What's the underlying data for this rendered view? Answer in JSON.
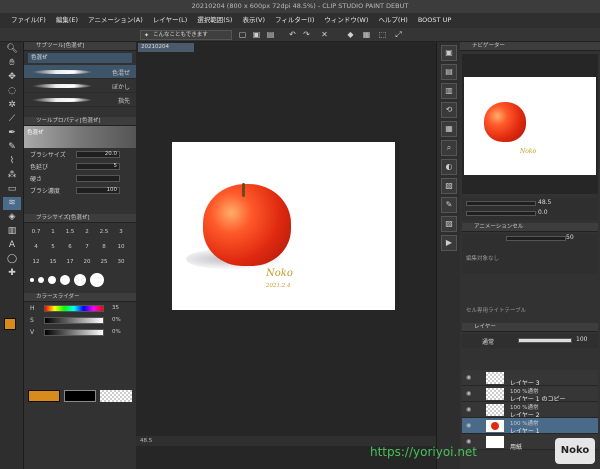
{
  "window": {
    "title": "20210204 (800 x 600px 72dpi 48.5%) - CLIP STUDIO PAINT DEBUT"
  },
  "menubar": [
    "ファイル(F)",
    "編集(E)",
    "アニメーション(A)",
    "レイヤー(L)",
    "選択範囲(S)",
    "表示(V)",
    "フィルター(I)",
    "ウィンドウ(W)",
    "ヘルプ(H)",
    "BOOST UP"
  ],
  "cmdbar": {
    "help_text": "こんなこともできます"
  },
  "document": {
    "tab": "20210204"
  },
  "subtool": {
    "panel_title": "サブツール[色混ぜ]",
    "group": "色混ぜ",
    "items": [
      "色混ぜ",
      "ぼかし",
      "指先"
    ]
  },
  "tool_property": {
    "panel_title": "ツールプロパティ[色混ぜ]",
    "name": "色混ぜ",
    "rows": [
      {
        "label": "ブラシサイズ",
        "value": "20.0"
      },
      {
        "label": "色延び",
        "value": "5"
      },
      {
        "label": "硬さ",
        "value": ""
      },
      {
        "label": "ブラシ濃度",
        "value": "100"
      }
    ]
  },
  "brush_size": {
    "panel_title": "ブラシサイズ[色混ぜ]",
    "sizes": [
      "0.7",
      "1",
      "1.5",
      "2",
      "2.5",
      "3",
      "4",
      "5",
      "6",
      "7",
      "8",
      "10",
      "12",
      "15",
      "17",
      "20",
      "25",
      "30"
    ]
  },
  "color_slider": {
    "panel_title": "カラースライダー",
    "rows": [
      {
        "label": "H",
        "value": "35"
      },
      {
        "label": "S",
        "value": "0%"
      },
      {
        "label": "V",
        "value": "0%"
      }
    ]
  },
  "artwork": {
    "signature": "Noko",
    "date": "2021.2.4"
  },
  "navigator": {
    "panel_title": "ナビゲーター",
    "zoom": "48.5",
    "angle": "0.0"
  },
  "animation_cel": {
    "panel_title": "アニメーションセル",
    "value": "50"
  },
  "light_table": {
    "text": "編集対象なし",
    "subtext": "セル専用ライトテーブル"
  },
  "layer_panel": {
    "panel_title": "レイヤー",
    "blend_mode": "通常",
    "opacity": "100",
    "layers": [
      {
        "line1": "",
        "line2": "レイヤー 3"
      },
      {
        "line1": "100 %通常",
        "line2": "レイヤー 1 のコピー"
      },
      {
        "line1": "100 %通常",
        "line2": "レイヤー 2"
      },
      {
        "line1": "100 %通常",
        "line2": "レイヤー 1"
      },
      {
        "line1": "",
        "line2": "用紙"
      }
    ]
  },
  "status": {
    "zoom": "48.5"
  },
  "watermark": {
    "url": "https://yoriyoi.net",
    "logo": "Noko"
  },
  "colors": {
    "main_color": "#d88a1c",
    "sub_color": "#000000"
  }
}
